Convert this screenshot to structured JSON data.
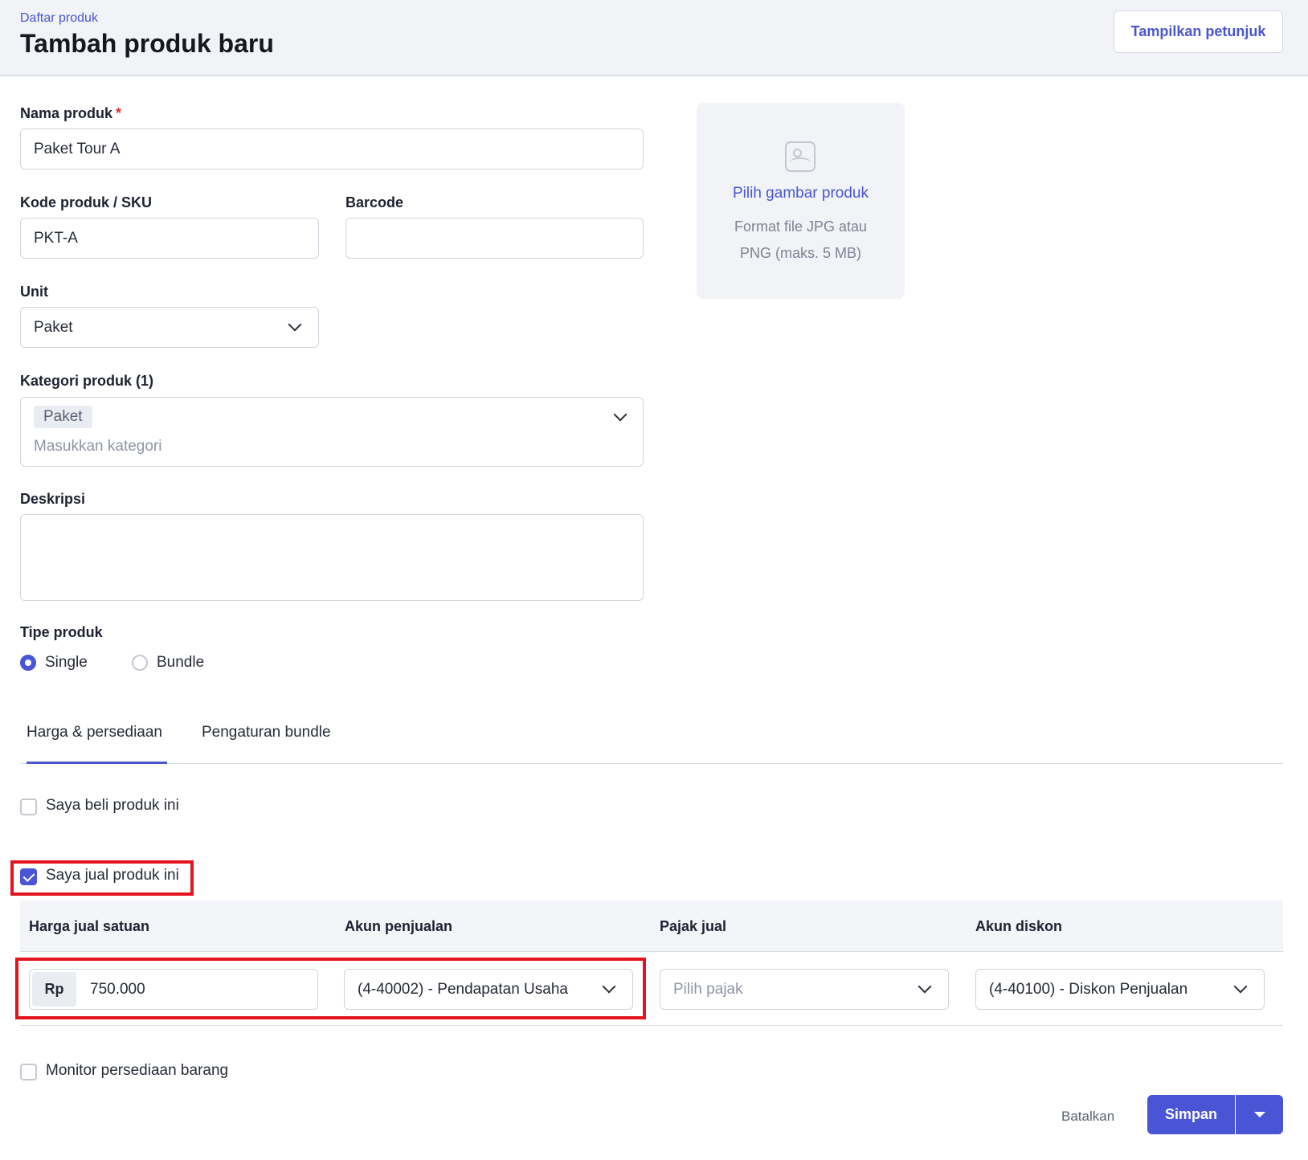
{
  "header": {
    "breadcrumb": "Daftar produk",
    "title": "Tambah produk baru",
    "guide_button": "Tampilkan petunjuk"
  },
  "form": {
    "name_label": "Nama produk",
    "name_required": "*",
    "name_value": "Paket Tour A",
    "sku_label": "Kode produk / SKU",
    "sku_value": "PKT-A",
    "barcode_label": "Barcode",
    "barcode_value": "",
    "unit_label": "Unit",
    "unit_value": "Paket",
    "category_label": "Kategori produk (1)",
    "category_tag": "Paket",
    "category_placeholder": "Masukkan kategori",
    "description_label": "Deskripsi",
    "description_value": "",
    "type_label": "Tipe produk",
    "type_options": [
      "Single",
      "Bundle"
    ],
    "type_selected": "Single"
  },
  "image_upload": {
    "link": "Pilih gambar produk",
    "hint": "Format file JPG atau PNG (maks. 5 MB)"
  },
  "tabs": [
    "Harga & persediaan",
    "Pengaturan bundle"
  ],
  "active_tab": "Harga & persediaan",
  "buy_checkbox": {
    "label": "Saya beli produk ini",
    "checked": false
  },
  "sell_checkbox": {
    "label": "Saya jual produk ini",
    "checked": true
  },
  "sell_table": {
    "headers": [
      "Harga jual satuan",
      "Akun penjualan",
      "Pajak jual",
      "Akun diskon"
    ],
    "currency": "Rp",
    "price_value": "750.000",
    "sales_account": "(4-40002) - Pendapatan Usaha",
    "tax_placeholder": "Pilih pajak",
    "discount_account": "(4-40100) - Diskon Penjualan"
  },
  "inventory_checkbox": {
    "label": "Monitor persediaan barang",
    "checked": false
  },
  "footer": {
    "cancel": "Batalkan",
    "save": "Simpan"
  },
  "colors": {
    "accent": "#4a55d6",
    "highlight": "#e3141e",
    "header_bg": "#f1f3f7"
  }
}
